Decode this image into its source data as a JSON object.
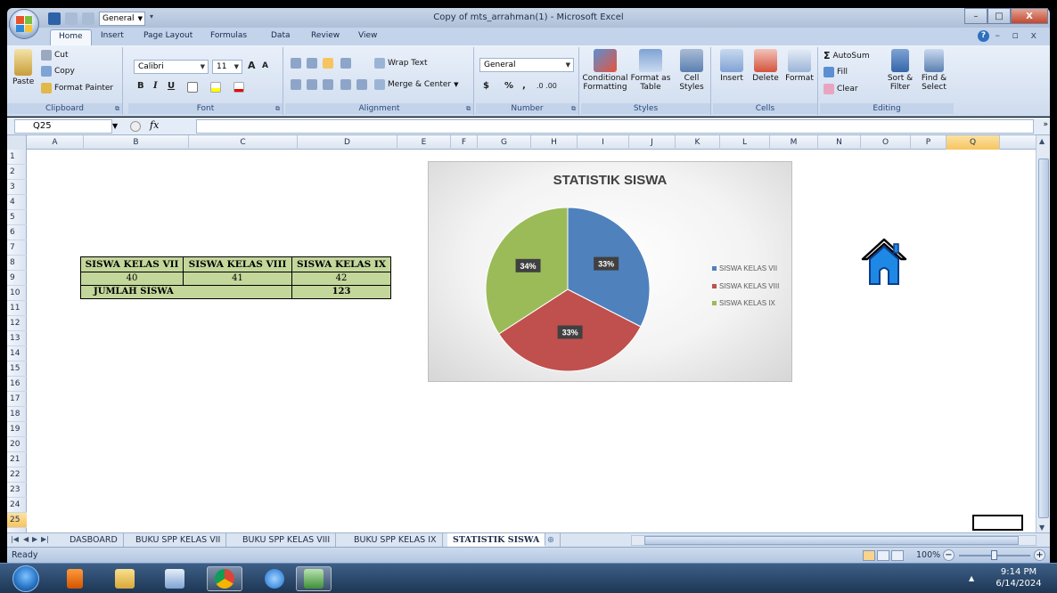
{
  "window": {
    "title": "Copy of mts_arrahman(1) - Microsoft Excel",
    "qat_style_combo": "General",
    "controls": {
      "minimize": "–",
      "maximize": "□",
      "close": "X"
    }
  },
  "ribbon_tabs": [
    "Home",
    "Insert",
    "Page Layout",
    "Formulas",
    "Data",
    "Review",
    "View"
  ],
  "ribbon": {
    "clipboard": {
      "label": "Clipboard",
      "paste": "Paste",
      "cut": "Cut",
      "copy": "Copy",
      "format_painter": "Format Painter"
    },
    "font": {
      "label": "Font",
      "name": "Calibri",
      "size": "11",
      "bold": "B",
      "italic": "I",
      "underline": "U",
      "grow": "A",
      "shrink": "A"
    },
    "alignment": {
      "label": "Alignment",
      "wrap_text": "Wrap Text",
      "merge_center": "Merge & Center"
    },
    "number": {
      "label": "Number",
      "format": "General",
      "currency": "$",
      "percent": "%",
      "comma": ",",
      "inc_dec": ".0 .00"
    },
    "styles": {
      "label": "Styles",
      "conditional": "Conditional Formatting",
      "format_table": "Format as Table",
      "cell_styles": "Cell Styles"
    },
    "cells": {
      "label": "Cells",
      "insert": "Insert",
      "delete": "Delete",
      "format": "Format"
    },
    "editing": {
      "label": "Editing",
      "autosum": "AutoSum",
      "fill": "Fill",
      "clear": "Clear",
      "sort_filter": "Sort & Filter",
      "find_select": "Find & Select"
    }
  },
  "formula_bar": {
    "name_box": "Q25",
    "fx": "fx",
    "value": ""
  },
  "columns": [
    "A",
    "B",
    "C",
    "D",
    "E",
    "F",
    "G",
    "H",
    "I",
    "J",
    "K",
    "L",
    "M",
    "N",
    "O",
    "P",
    "Q"
  ],
  "rows": [
    "1",
    "2",
    "3",
    "4",
    "5",
    "6",
    "7",
    "8",
    "9",
    "10",
    "11",
    "12",
    "13",
    "14",
    "15",
    "16",
    "17",
    "18",
    "19",
    "20",
    "21",
    "22",
    "23",
    "24",
    "25"
  ],
  "selected_cell": "Q25",
  "table": {
    "headers": [
      "SISWA KELAS VII",
      "SISWA KELAS VIII",
      "SISWA KELAS IX"
    ],
    "values": [
      "40",
      "41",
      "42"
    ],
    "total_label": "JUMLAH SISWA",
    "total_value": "123"
  },
  "chart_data": {
    "type": "pie",
    "title": "STATISTIK SISWA",
    "categories": [
      "SISWA KELAS VII",
      "SISWA KELAS VIII",
      "SISWA KELAS IX"
    ],
    "values": [
      40,
      41,
      42
    ],
    "labels": [
      "33%",
      "33%",
      "34%"
    ],
    "colors": [
      "#4f81bd",
      "#c0504d",
      "#9bbb59"
    ],
    "legend": "right"
  },
  "sheet_tabs": [
    "DASBOARD",
    "BUKU SPP KELAS VII",
    "BUKU SPP KELAS VIII",
    "BUKU SPP KELAS IX",
    "STATISTIK SISWA"
  ],
  "active_sheet": "STATISTIK SISWA",
  "status": {
    "text": "Ready",
    "zoom": "100%"
  },
  "taskbar": {
    "time": "9:14 PM",
    "date": "6/14/2024"
  }
}
